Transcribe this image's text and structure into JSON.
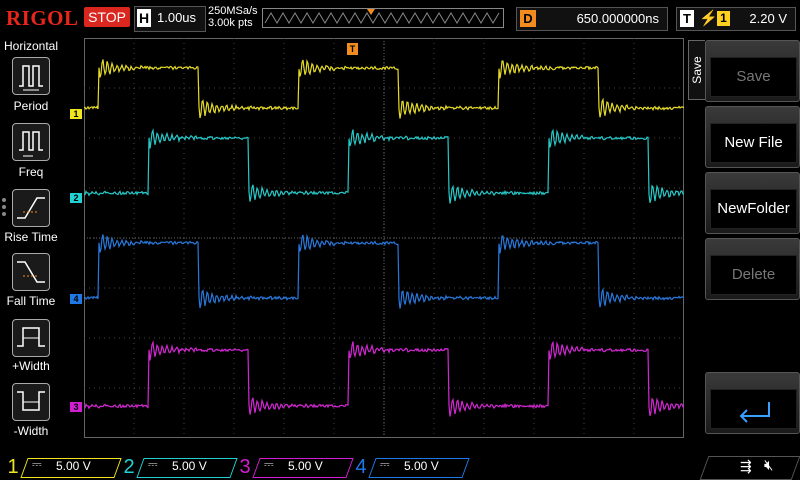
{
  "header": {
    "logo": "RIGOL",
    "run_state": "STOP",
    "horizontal_label": "H",
    "timebase": "1.00us",
    "sample_rate": "250MSa/s",
    "memory_depth": "3.00k pts",
    "delay_label": "D",
    "delay_value": "650.000000ns",
    "trigger_label": "T",
    "trigger_source": "1",
    "trigger_level": "2.20 V"
  },
  "left_menu": {
    "title": "Horizontal",
    "items": [
      {
        "label": "Period",
        "icon": "period-icon"
      },
      {
        "label": "Freq",
        "icon": "freq-icon"
      },
      {
        "label": "Rise Time",
        "icon": "rise-time-icon"
      },
      {
        "label": "Fall Time",
        "icon": "fall-time-icon"
      },
      {
        "label": "+Width",
        "icon": "pos-width-icon"
      },
      {
        "label": "-Width",
        "icon": "neg-width-icon"
      }
    ]
  },
  "right_menu": {
    "tab_label": "Save",
    "items": [
      {
        "label": "Save",
        "enabled": false
      },
      {
        "label": "New File",
        "enabled": true
      },
      {
        "label": "NewFolder",
        "enabled": true
      },
      {
        "label": "Delete",
        "enabled": false
      },
      {
        "label": "",
        "icon": "enter-icon",
        "enabled": true
      }
    ]
  },
  "channels": [
    {
      "id": "1",
      "scale": "5.00 V",
      "color": "#f0e61e",
      "active": true
    },
    {
      "id": "2",
      "scale": "5.00 V",
      "color": "#22d2d2",
      "active": false
    },
    {
      "id": "3",
      "scale": "5.00 V",
      "color": "#d21ed2",
      "active": false
    },
    {
      "id": "4",
      "scale": "5.00 V",
      "color": "#1e78e6",
      "active": false
    }
  ],
  "channel_markers": [
    "1",
    "2",
    "4",
    "3"
  ],
  "trigger_marker": "T",
  "status_icons": [
    "usb-icon",
    "speaker-muted-icon"
  ],
  "colors": {
    "ch1": "#e6dc28",
    "ch2": "#28c8c8",
    "ch3": "#d228d2",
    "ch4": "#2878dc",
    "trigger": "#f28c1e",
    "run_stop": "#d9261f"
  }
}
